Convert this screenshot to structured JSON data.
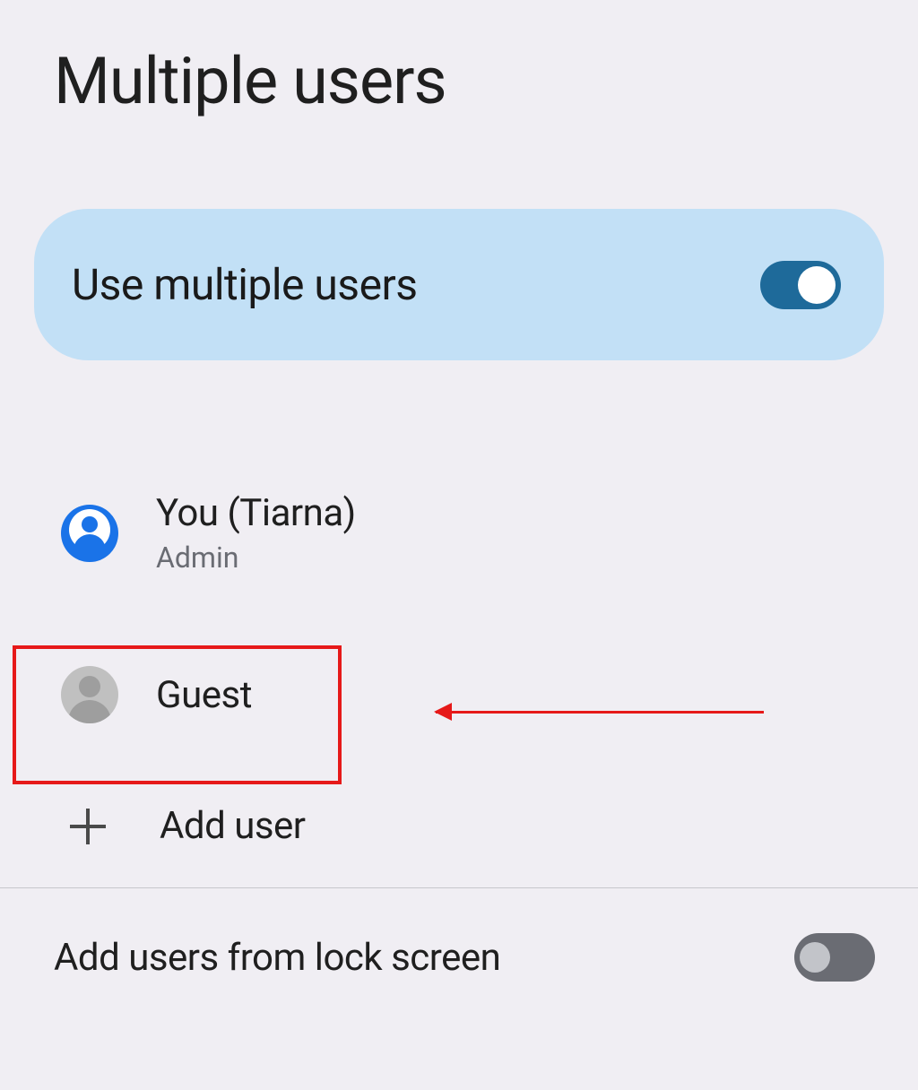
{
  "page": {
    "title": "Multiple users"
  },
  "toggleCard": {
    "label": "Use multiple users",
    "enabled": true
  },
  "users": {
    "current": {
      "name": "You (Tiarna)",
      "role": "Admin"
    },
    "guest": {
      "name": "Guest"
    },
    "addUser": {
      "label": "Add user"
    }
  },
  "lockScreen": {
    "label": "Add users from lock screen",
    "enabled": false
  }
}
